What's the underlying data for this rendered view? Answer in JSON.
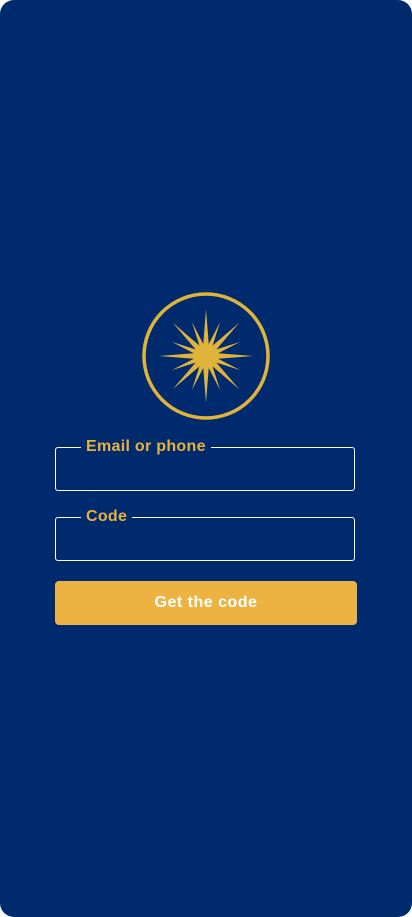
{
  "colors": {
    "background": "#002a6e",
    "accent": "#ecb342",
    "label": "#e8b13c",
    "emblem": "#e0b43a",
    "field_border": "#ffffff"
  },
  "emblem": {
    "icon": "vergina-sun-icon"
  },
  "form": {
    "email_label": "Email or phone",
    "email_value": "",
    "email_placeholder": "",
    "code_label": "Code",
    "code_value": "",
    "code_placeholder": "",
    "submit_label": "Get the code"
  }
}
